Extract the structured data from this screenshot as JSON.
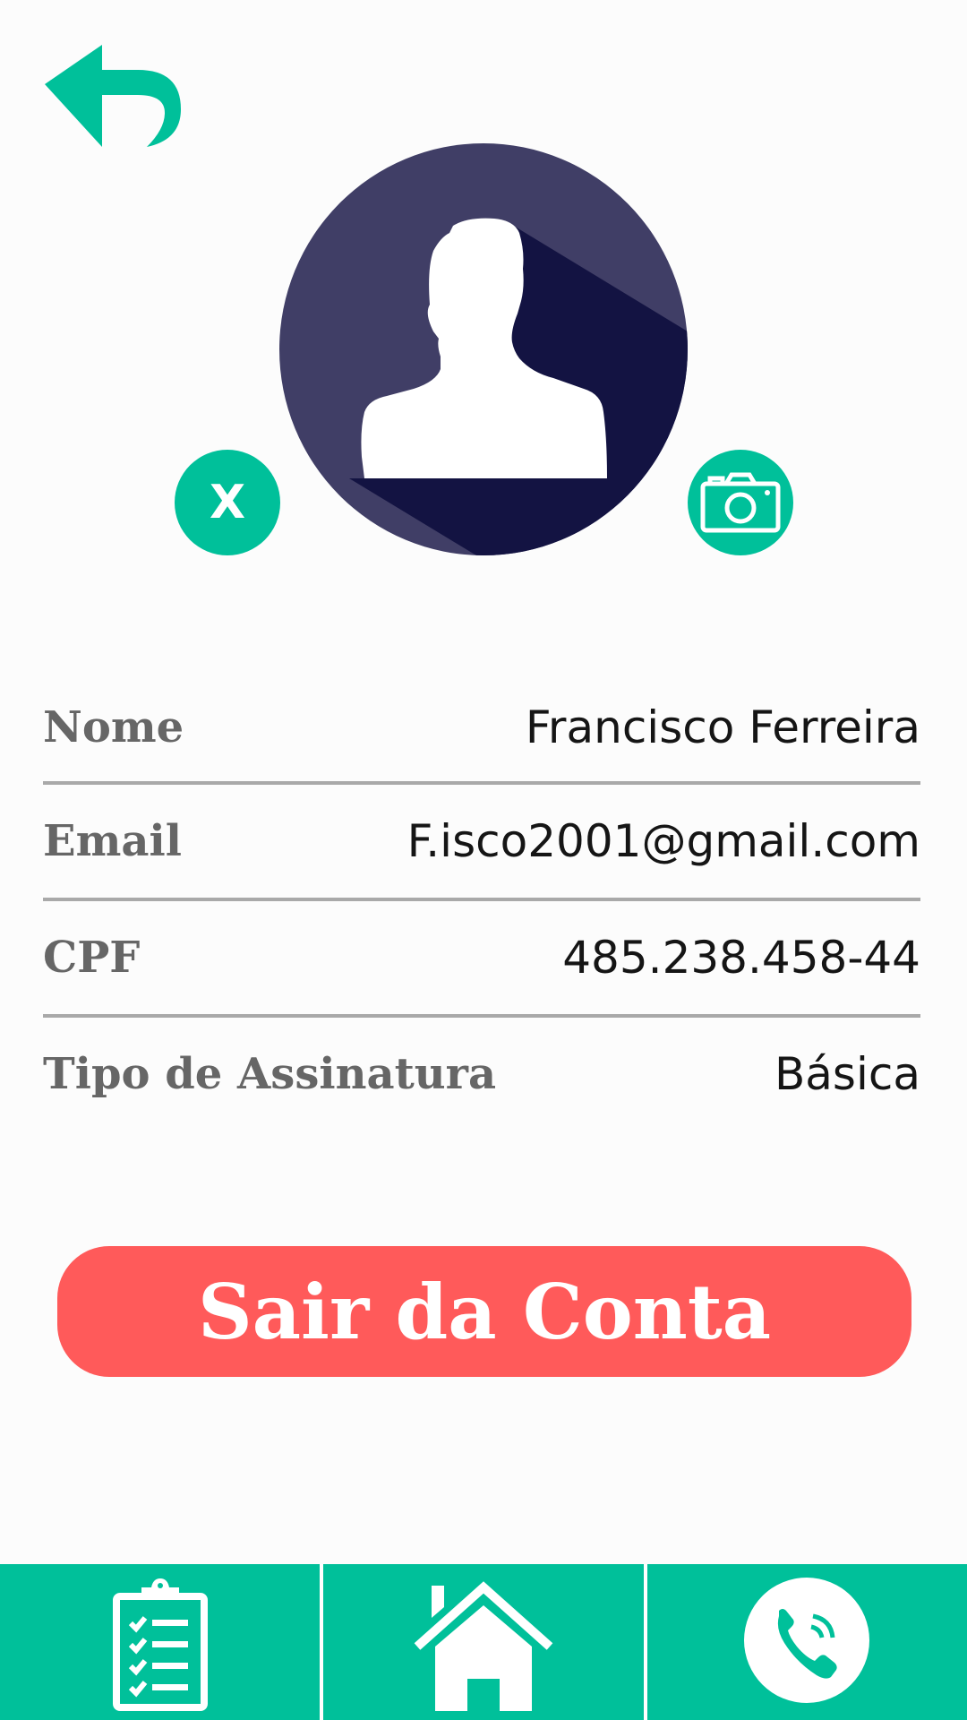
{
  "colors": {
    "accent": "#00c09a",
    "danger": "#ff5a5a",
    "avatar_bg": "#403e66",
    "avatar_shadow": "#131342"
  },
  "icons": {
    "back": "back-arrow-icon",
    "avatar": "user-silhouette-icon",
    "remove_photo": "x-icon",
    "camera": "camera-icon",
    "nav_tasks": "clipboard-checklist-icon",
    "nav_home": "home-icon",
    "nav_call": "phone-icon"
  },
  "profile": {
    "remove_photo_label": "X",
    "fields": [
      {
        "label": "Nome",
        "value": "Francisco Ferreira"
      },
      {
        "label": "Email",
        "value": "F.isco2001@gmail.com"
      },
      {
        "label": "CPF",
        "value": "485.238.458-44"
      },
      {
        "label": "Tipo de Assinatura",
        "value": "Básica"
      }
    ]
  },
  "actions": {
    "logout_label": "Sair da Conta"
  }
}
